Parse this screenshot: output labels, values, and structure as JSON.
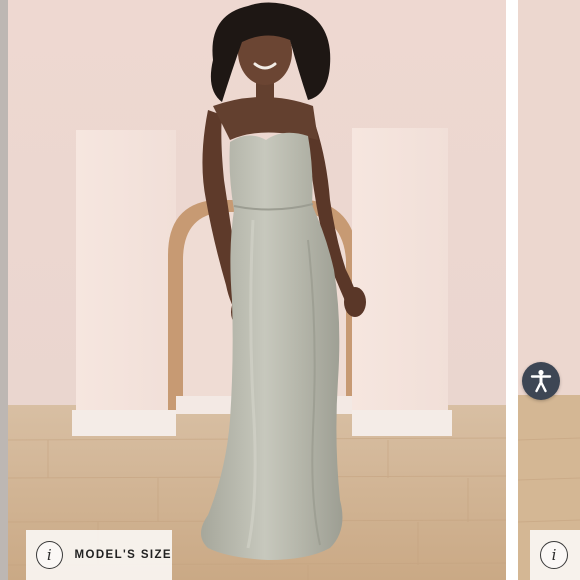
{
  "gallery": {
    "size_chip_label": "MODEL'S SIZE",
    "info_glyph": "i",
    "icons": [
      "info-icon",
      "accessibility-icon"
    ]
  },
  "colors": {
    "wall": "#ecd9d2",
    "floor": "#d9bc9a",
    "dress": "#b9baae",
    "accessibility_button": "#3d4654"
  }
}
